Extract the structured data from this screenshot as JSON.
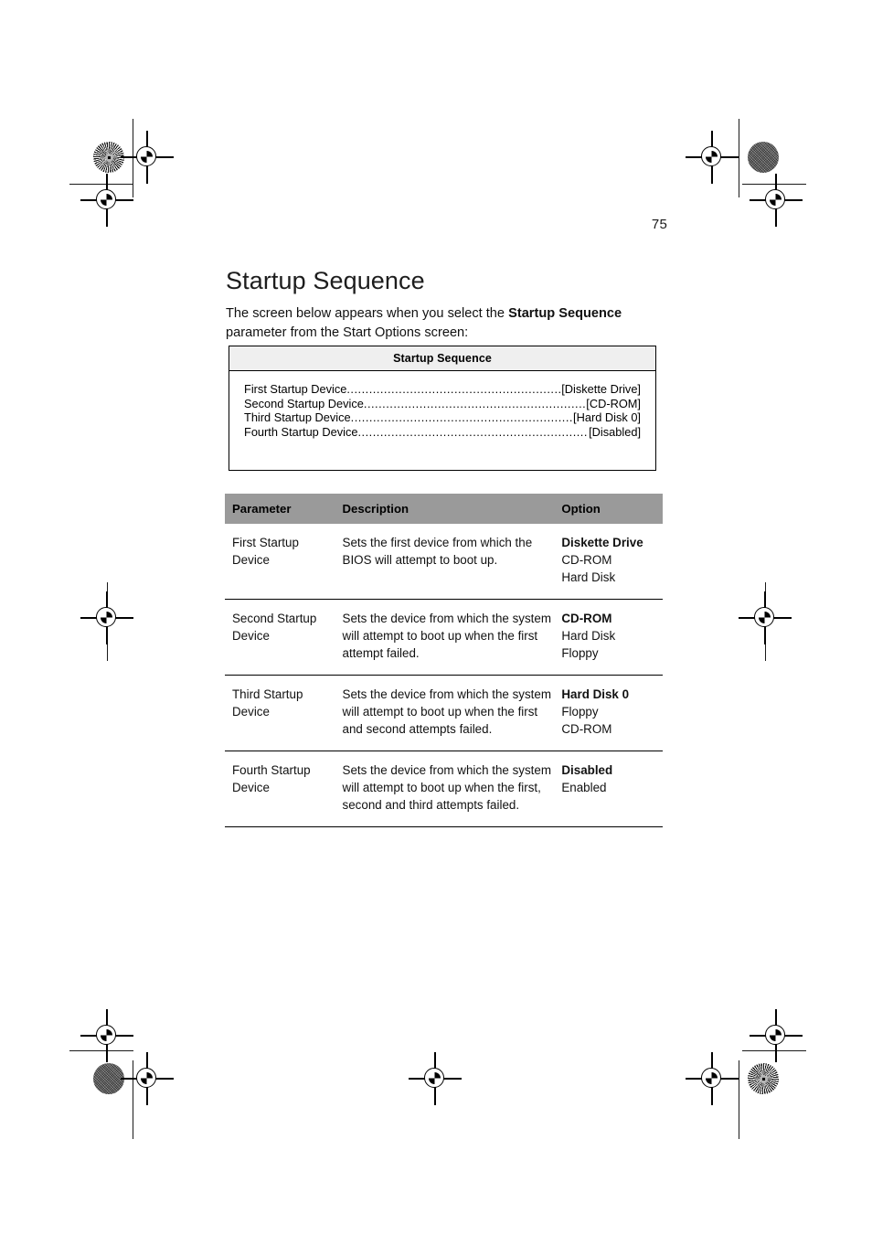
{
  "page": {
    "folio": "75",
    "title": "Startup Sequence",
    "intro_before": "The screen below appears when you select the ",
    "intro_bold": "Startup Sequence",
    "intro_after": " parameter from the Start Options screen:"
  },
  "bios_screen": {
    "title": "Startup Sequence",
    "lines": [
      {
        "label": "First Startup Device",
        "value": "[Diskette Drive]"
      },
      {
        "label": "Second Startup Device",
        "value": "[CD-ROM]"
      },
      {
        "label": "Third Startup Device",
        "value": "[Hard Disk 0]"
      },
      {
        "label": "Fourth Startup Device",
        "value": "[Disabled]"
      }
    ]
  },
  "table": {
    "headers": {
      "parameter": "Parameter",
      "description": "Description",
      "option": "Option"
    },
    "rows": [
      {
        "parameter": "First Startup Device",
        "description": "Sets the first device from which the BIOS will attempt to boot up.",
        "option_default": "Diskette Drive",
        "option_alternatives": [
          "CD-ROM",
          "Hard Disk"
        ]
      },
      {
        "parameter": "Second Startup Device",
        "description": "Sets the device from which the system will attempt to boot up when the first attempt failed.",
        "option_default": "CD-ROM",
        "option_alternatives": [
          "Hard Disk",
          "Floppy"
        ]
      },
      {
        "parameter": "Third Startup Device",
        "description": "Sets the device from which the system will attempt to boot up when the first and second attempts failed.",
        "option_default": "Hard Disk 0",
        "option_alternatives": [
          "Floppy",
          "CD-ROM"
        ]
      },
      {
        "parameter": "Fourth Startup Device",
        "description": "Sets the device from which the system will attempt to boot up when the first, second and third attempts failed.",
        "option_default": "Disabled",
        "option_alternatives": [
          "Enabled"
        ]
      }
    ]
  },
  "colors": {
    "table_header_bg": "#9a9a9a",
    "bios_header_bg": "#efefef",
    "rule": "#000000",
    "text": "#111111"
  }
}
